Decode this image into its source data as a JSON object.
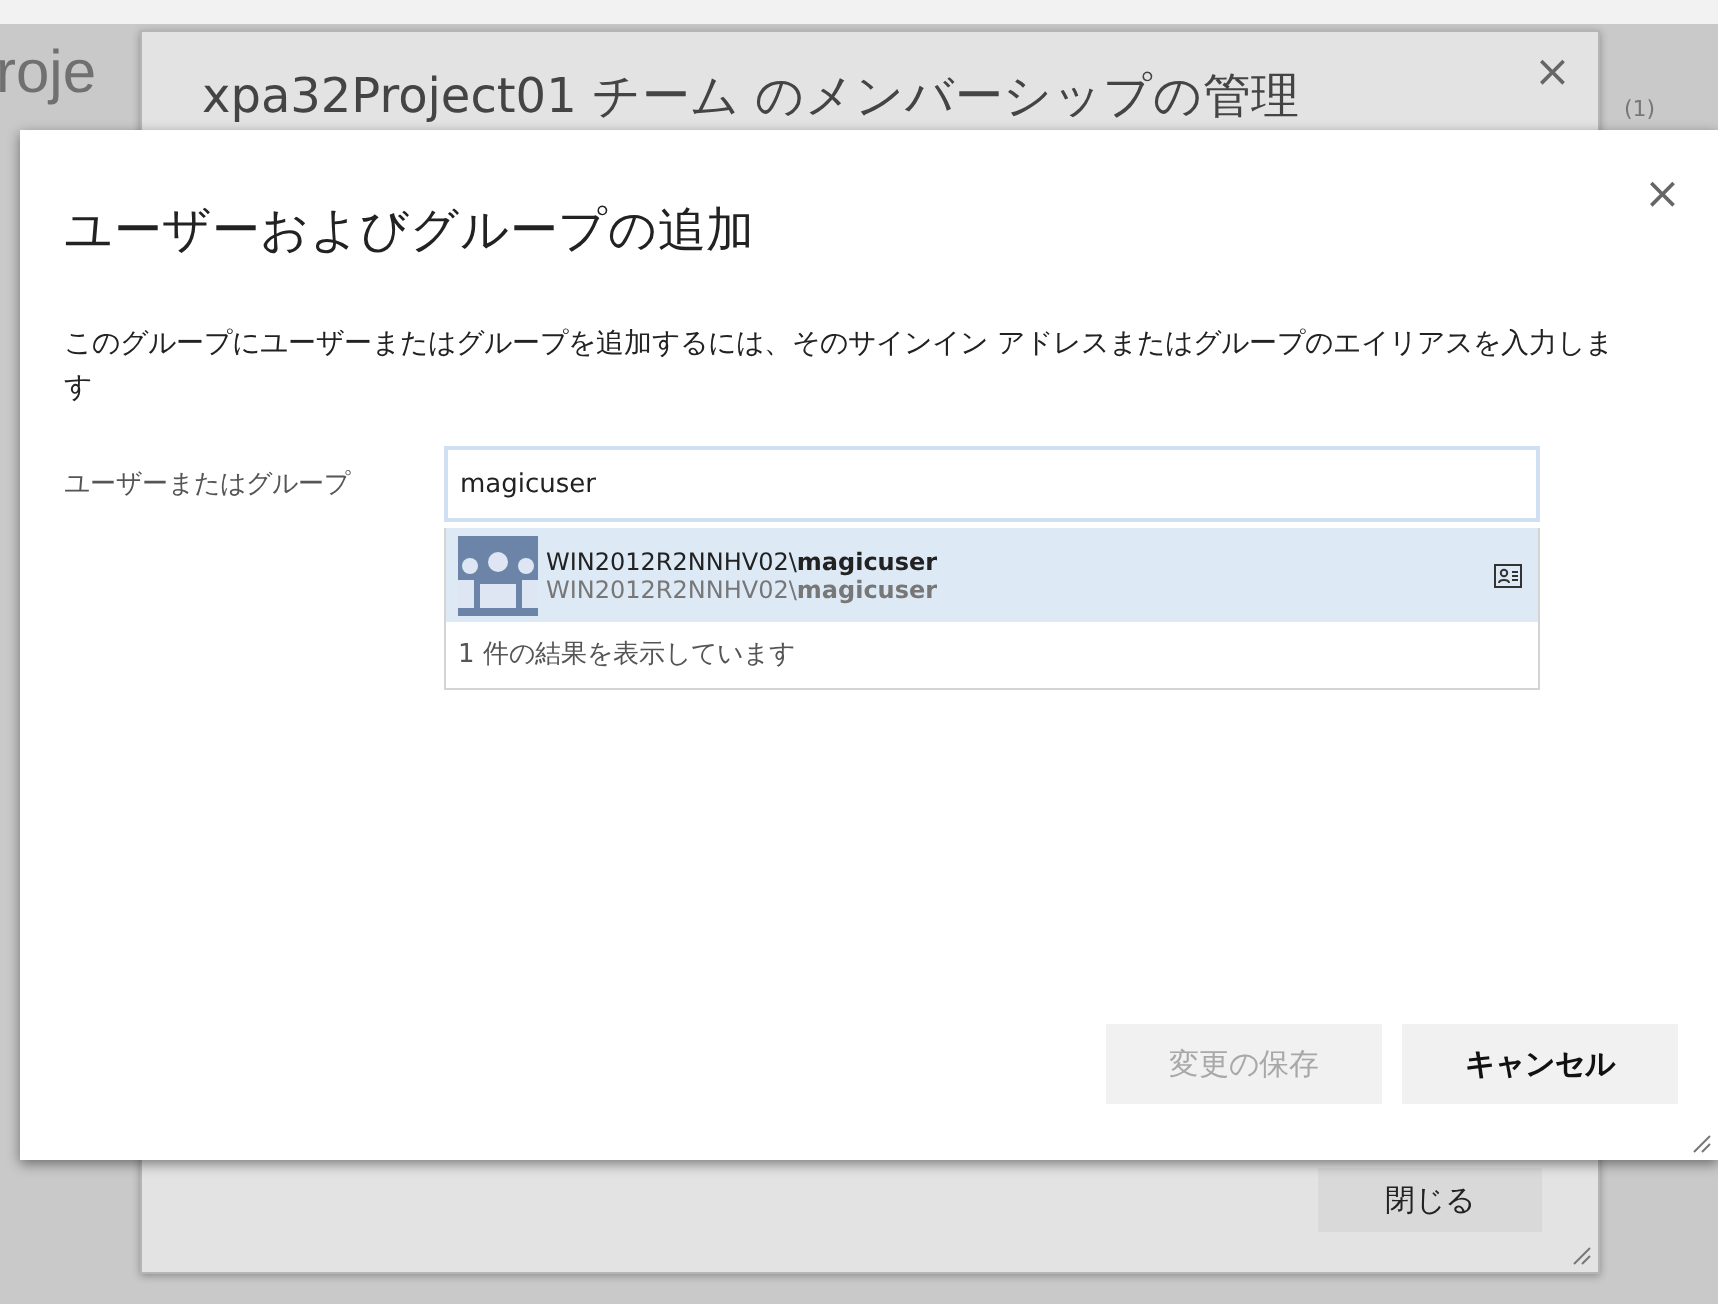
{
  "background": {
    "heading": "roje",
    "count": "(1)"
  },
  "back_dialog": {
    "title": "xpa32Project01 チーム のメンバーシップの管理",
    "close": "×",
    "button": "閉じる"
  },
  "dialog": {
    "title": "ユーザーおよびグループの追加",
    "close": "×",
    "description": "このグループにユーザーまたはグループを追加するには、そのサインイン アドレスまたはグループのエイリアスを入力します",
    "field_label": "ユーザーまたはグループ",
    "field_value": "magicuser",
    "suggestions": [
      {
        "name": "WIN2012R2NNHV02\\**magicuser**",
        "account": "WIN2012R2NNHV02\\**magicuser**",
        "selected": true
      }
    ],
    "result_count": "1 件の結果を表示しています",
    "buttons": [
      {
        "label": "変更の保存",
        "disabled": true
      },
      {
        "label": "キャンセル",
        "disabled": false
      }
    ]
  }
}
